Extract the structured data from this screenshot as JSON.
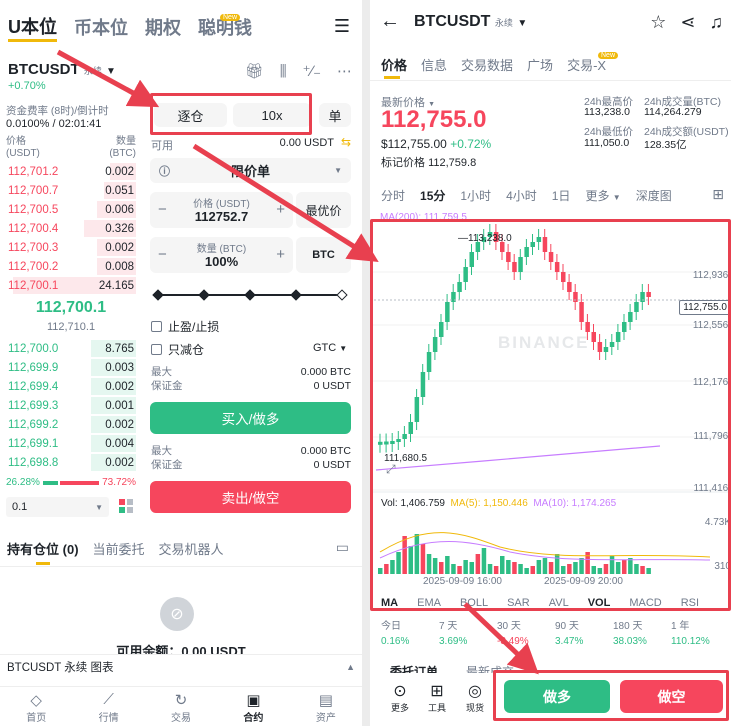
{
  "left": {
    "nav": [
      "U本位",
      "币本位",
      "期权",
      "聪明钱"
    ],
    "nav_new": "New",
    "symbol": "BTCUSDT",
    "symbol_type": "永续",
    "change": "+0.70%",
    "funding_label": "资金费率 (8时)/倒计时",
    "funding_value": "0.0100% / 02:01:41",
    "ob_price_h": "价格",
    "ob_price_unit": "(USDT)",
    "ob_qty_h": "数量",
    "ob_qty_unit": "(BTC)",
    "asks": [
      [
        "112,701.2",
        "0.002"
      ],
      [
        "112,700.7",
        "0.051"
      ],
      [
        "112,700.5",
        "0.006"
      ],
      [
        "112,700.4",
        "0.326"
      ],
      [
        "112,700.3",
        "0.002"
      ],
      [
        "112,700.2",
        "0.008"
      ],
      [
        "112,700.1",
        "24.165"
      ]
    ],
    "asks_fill": [
      0.2,
      0.25,
      0.3,
      0.4,
      0.3,
      0.3,
      0.95
    ],
    "mid_price": "112,700.1",
    "mark_price": "112,710.1",
    "bids": [
      [
        "112,700.0",
        "8.765"
      ],
      [
        "112,699.9",
        "0.003"
      ],
      [
        "112,699.4",
        "0.002"
      ],
      [
        "112,699.3",
        "0.001"
      ],
      [
        "112,699.2",
        "0.002"
      ],
      [
        "112,699.1",
        "0.004"
      ],
      [
        "112,698.8",
        "0.002"
      ]
    ],
    "bids_fill": [
      0.35,
      0.35,
      0.35,
      0.35,
      0.35,
      0.35,
      0.35
    ],
    "buy_ratio": "26.28%",
    "sell_ratio": "73.72%",
    "buy_ratio_value": 26.28,
    "tick_size": "0.1",
    "margin_mode": "逐仓",
    "leverage": "10x",
    "single": "单",
    "avail_label": "可用",
    "avail_value": "0.00 USDT",
    "order_type": "限价单",
    "price_label": "价格 (USDT)",
    "price_value": "112752.7",
    "best_price": "最优价",
    "qty_label": "数量 (BTC)",
    "qty_value": "100%",
    "qty_unit": "BTC",
    "tpsl": "止盈/止损",
    "reduce_only": "只减仓",
    "tif": "GTC",
    "max_label": "最大",
    "max_buy": "0.000 BTC",
    "margin_label": "保证金",
    "margin_buy": "0 USDT",
    "buy_btn": "买入/做多",
    "max_sell": "0.000 BTC",
    "margin_sell": "0 USDT",
    "sell_btn": "卖出/做空",
    "tabs": [
      "持有仓位",
      "当前委托",
      "交易机器人"
    ],
    "pos_count": "(0)",
    "avail_bal": "可用余额：0.00 USDT",
    "bottom_symbol": "BTCUSDT 永续",
    "bottom_chart": "图表",
    "tabbar": [
      "首页",
      "行情",
      "交易",
      "合约",
      "资产"
    ]
  },
  "right": {
    "symbol": "BTCUSDT",
    "symbol_type": "永续",
    "tabs": [
      "价格",
      "信息",
      "交易数据",
      "广场",
      "交易-X"
    ],
    "tab_new": "New",
    "last_label": "最新价格",
    "last_price": "112,755.0",
    "last_usd": "$112,755.00",
    "last_change": "+0.72%",
    "mark_label": "标记价格",
    "mark_value": "112,759.8",
    "h24_high_label": "24h最高价",
    "h24_high": "113,238.0",
    "h24_low_label": "24h最低价",
    "h24_low": "111,050.0",
    "vol_btc_label": "24h成交量(BTC)",
    "vol_btc": "114,264.279",
    "vol_usdt_label": "24h成交额(USDT)",
    "vol_usdt": "128.35亿",
    "intervals": [
      "分时",
      "15分",
      "1小时",
      "4小时",
      "1日",
      "更多",
      "深度图"
    ],
    "ma_label": "MA(200): 111,759.5",
    "watermark": "BINANCE",
    "axis_prices": [
      "112,936.",
      "112,556.",
      "112,176.",
      "111,796.",
      "111,416."
    ],
    "current_price_tag": "112,755.0",
    "high_annot": "113,238.0",
    "low_annot": "111,680.5",
    "vol_line": "Vol: 1,406.759",
    "vol_ma5": "MA(5): 1,150.446",
    "vol_ma10": "MA(10): 1,174.265",
    "vol_axis_top": "4.73K",
    "vol_axis_bot": "310",
    "time_labels": [
      "2025-09-09 16:00",
      "2025-09-09 20:00"
    ],
    "indicators": [
      "MA",
      "EMA",
      "BOLL",
      "SAR",
      "AVL",
      "VOL",
      "MACD",
      "RSI"
    ],
    "perf_labels": [
      "今日",
      "7 天",
      "30 天",
      "90 天",
      "180 天",
      "1 年"
    ],
    "perf_values": [
      "0.16%",
      "3.69%",
      "-3.49%",
      "3.47%",
      "38.03%",
      "110.12%"
    ],
    "bottom_tabs": [
      "委托订单",
      "最新成交"
    ],
    "tools": [
      "更多",
      "工具",
      "现货"
    ],
    "long_btn": "做多",
    "short_btn": "做空",
    "colors": {
      "up": "#2ebd85",
      "down": "#f6465d",
      "accent": "#f0b90b",
      "annot": "#e8404f"
    }
  }
}
